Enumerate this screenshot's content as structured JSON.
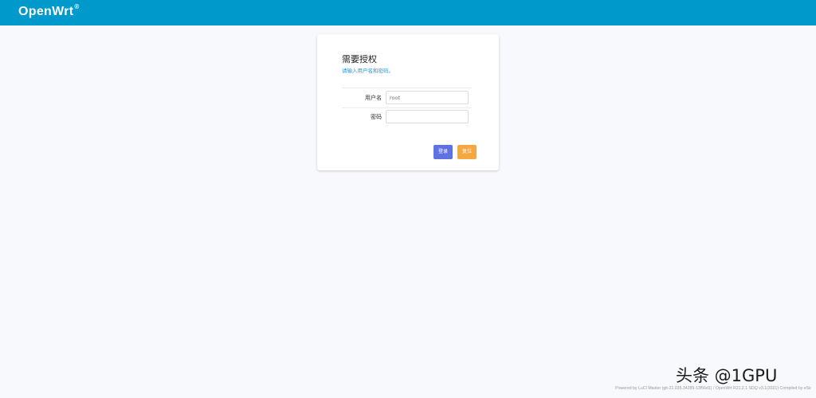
{
  "header": {
    "brand": "OpenWrt",
    "brand_mark": "®"
  },
  "login": {
    "title": "需要授权",
    "subtitle": "请输入用户名和密码。",
    "username_label": "用户名",
    "username_placeholder": "root",
    "password_label": "密码",
    "password_placeholder": "",
    "login_button": "登录",
    "reset_button": "复位"
  },
  "watermark": "头条 @1GPU",
  "footer": "Powered by LuCI Master (git-21.035.34289-13f56d1) / OpenWrt R21.2.1 SDQ v3.1(2021) Compiled by eSir",
  "colors": {
    "header": "#0099cc",
    "login_button": "#5e72e4",
    "reset_button": "#f5a742",
    "subtitle": "#2a96d6",
    "background": "#f7f9fc"
  }
}
